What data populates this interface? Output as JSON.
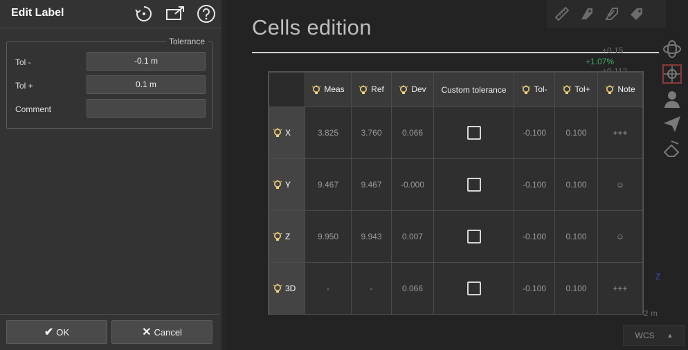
{
  "panel": {
    "title": "Edit Label",
    "tolerance_group": "Tolerance",
    "fields": [
      {
        "label": "Tol -",
        "value": "-0.1 m"
      },
      {
        "label": "Tol +",
        "value": "0.1 m"
      },
      {
        "label": "Comment",
        "value": ""
      }
    ],
    "ok_label": "OK",
    "cancel_label": "Cancel"
  },
  "view": {
    "title": "Cells edition",
    "bg_readouts": [
      "+0.15",
      "+1.07%",
      "+0.112"
    ],
    "scale_text": "2 m",
    "axis_z": "Z",
    "wcs_label": "WCS"
  },
  "table": {
    "headers": [
      "Meas",
      "Ref",
      "Dev",
      "Custom tolerance",
      "Tol-",
      "Tol+",
      "Note"
    ],
    "rows": [
      {
        "label": "X",
        "meas": "3.825",
        "ref": "3.760",
        "dev": "0.066",
        "custom": false,
        "tol_minus": "-0.100",
        "tol_plus": "0.100",
        "note": "+++"
      },
      {
        "label": "Y",
        "meas": "9.467",
        "ref": "9.467",
        "dev": "-0.000",
        "custom": false,
        "tol_minus": "-0.100",
        "tol_plus": "0.100",
        "note": "☺"
      },
      {
        "label": "Z",
        "meas": "9.950",
        "ref": "9.943",
        "dev": "0.007",
        "custom": false,
        "tol_minus": "-0.100",
        "tol_plus": "0.100",
        "note": "☺"
      },
      {
        "label": "3D",
        "meas": "-",
        "ref": "-",
        "dev": "0.066",
        "custom": false,
        "tol_minus": "-0.100",
        "tol_plus": "0.100",
        "note": "+++"
      }
    ]
  },
  "colors": {
    "bulb": "#f0d27a",
    "readout_green": "#3fae6a"
  }
}
